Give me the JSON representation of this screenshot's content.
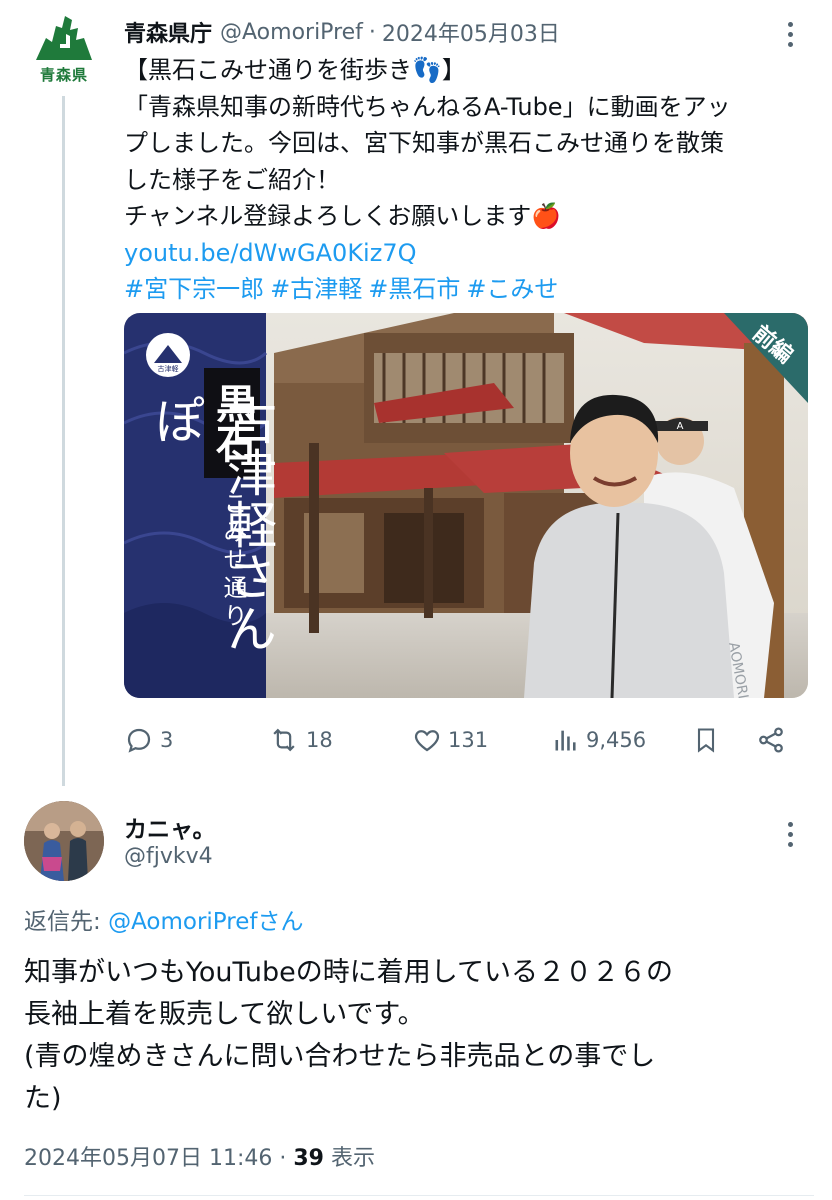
{
  "tweet": {
    "author_name": "青森県庁",
    "handle": "@AomoriPref",
    "separator": "·",
    "date": "2024年05月03日",
    "avatar_text": "青森県",
    "lines": [
      "【黒石こみせ通りを街歩き👣】",
      "「青森県知事の新時代ちゃんねるA-Tube」に動画をアッ",
      "プしました。今回は、宮下知事が黒石こみせ通りを散策",
      "した様子をご紹介！",
      "チャンネル登録よろしくお願いします🍎"
    ],
    "link": "youtu.be/dWwGA0Kiz7Q",
    "hashtags": [
      "#宮下宗一郎",
      "#古津軽",
      "#黒石市",
      "#こみせ"
    ]
  },
  "media": {
    "title_vertical": "古津軽さんぽ",
    "place_label": "黒石",
    "street_label": "こみせ通り",
    "badge": "前編",
    "emblem_text": "古津軽",
    "jacket_text": "AOMORI",
    "cap_text": "A"
  },
  "actions": {
    "reply_count": "3",
    "retweet_count": "18",
    "like_count": "131",
    "views_count": "9,456"
  },
  "reply": {
    "name": "カニャ。",
    "handle": "@fjvkv4",
    "reply_to_label": "返信先: ",
    "reply_to_target": "@AomoriPrefさん",
    "lines": [
      "知事がいつもYouTubeの時に着用している２０２６の",
      "長袖上着を販売して欲しいです。",
      "(青の煌めきさんに問い合わせたら非売品との事でし",
      "た)"
    ],
    "timestamp": "2024年05月07日 11:46 · ",
    "views": "39",
    "views_label": " 表示"
  },
  "colors": {
    "link": "#1d9bf0",
    "muted": "#536471",
    "text": "#0f1419",
    "thread_line": "#cfd9de",
    "brand_green": "#1f7a3b",
    "media_navy": "#26316f"
  }
}
